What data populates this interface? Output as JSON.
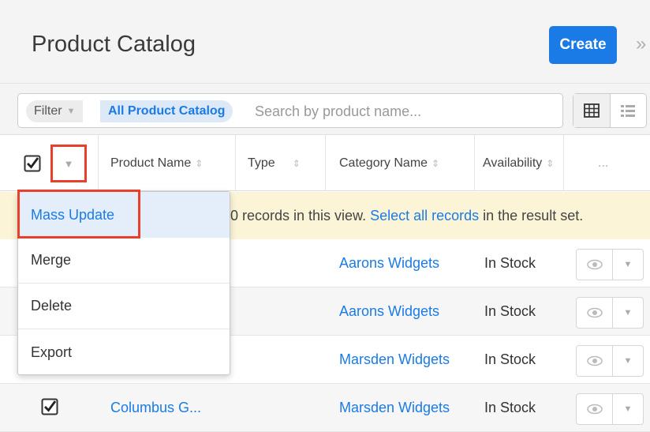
{
  "header": {
    "title": "Product Catalog",
    "create_label": "Create",
    "expand_icon": "double-chevron-right-icon"
  },
  "filter": {
    "filter_label": "Filter",
    "list_name": "All Product Catalog",
    "search_placeholder": "Search by product name..."
  },
  "columns": [
    "Product Name",
    "Type",
    "Category Name",
    "Availability",
    "..."
  ],
  "notice": {
    "prefix": "0 records in this view.",
    "link": "Select all records",
    "suffix": "in the result set."
  },
  "mass_actions": [
    {
      "label": "Mass Update",
      "highlighted": true
    },
    {
      "label": "Merge"
    },
    {
      "label": "Delete"
    },
    {
      "label": "Export"
    }
  ],
  "rows": [
    {
      "name": "",
      "category": "Aarons Widgets",
      "availability": "In Stock",
      "checked": false
    },
    {
      "name": "",
      "category": "Aarons Widgets",
      "availability": "In Stock",
      "checked": false
    },
    {
      "name": "",
      "category": "Marsden Widgets",
      "availability": "In Stock",
      "checked": false
    },
    {
      "name": "Columbus G...",
      "category": "Marsden Widgets",
      "availability": "In Stock",
      "checked": true
    }
  ],
  "colors": {
    "accent": "#1a7be6",
    "highlight_outline": "#e8402a",
    "notice_bg": "#fbf4d6"
  }
}
